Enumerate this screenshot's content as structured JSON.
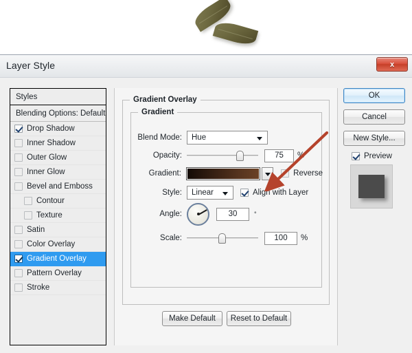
{
  "photo": {
    "alt": "two-dried-bay-leaves-on-white-background",
    "leaves": [
      {
        "name": "leaf-upper-left"
      },
      {
        "name": "leaf-lower-right"
      }
    ]
  },
  "dialog": {
    "title": "Layer Style",
    "close_label": "x"
  },
  "styles_panel": {
    "header": "Styles",
    "blending_options": "Blending Options: Default",
    "effects": [
      {
        "label": "Drop Shadow",
        "checked": true,
        "indent": false,
        "selected": false
      },
      {
        "label": "Inner Shadow",
        "checked": false,
        "indent": false,
        "selected": false
      },
      {
        "label": "Outer Glow",
        "checked": false,
        "indent": false,
        "selected": false
      },
      {
        "label": "Inner Glow",
        "checked": false,
        "indent": false,
        "selected": false
      },
      {
        "label": "Bevel and Emboss",
        "checked": false,
        "indent": false,
        "selected": false
      },
      {
        "label": "Contour",
        "checked": false,
        "indent": true,
        "selected": false
      },
      {
        "label": "Texture",
        "checked": false,
        "indent": true,
        "selected": false
      },
      {
        "label": "Satin",
        "checked": false,
        "indent": false,
        "selected": false
      },
      {
        "label": "Color Overlay",
        "checked": false,
        "indent": false,
        "selected": false
      },
      {
        "label": "Gradient Overlay",
        "checked": true,
        "indent": false,
        "selected": true
      },
      {
        "label": "Pattern Overlay",
        "checked": false,
        "indent": false,
        "selected": false
      },
      {
        "label": "Stroke",
        "checked": false,
        "indent": false,
        "selected": false
      }
    ]
  },
  "main": {
    "group_title": "Gradient Overlay",
    "subgroup_title": "Gradient",
    "blend_mode": {
      "label": "Blend Mode:",
      "value": "Hue"
    },
    "opacity": {
      "label": "Opacity:",
      "value": "75",
      "unit": "%",
      "percent": 75
    },
    "gradient": {
      "label": "Gradient:",
      "start_color": "#120a05",
      "end_color": "#6b4226",
      "reverse_label": "Reverse",
      "reverse_checked": false
    },
    "style": {
      "label": "Style:",
      "value": "Linear",
      "align_label": "Align with Layer",
      "align_checked": true
    },
    "angle": {
      "label": "Angle:",
      "value": "30",
      "unit": "°",
      "degrees": 30
    },
    "scale": {
      "label": "Scale:",
      "value": "100",
      "unit": "%",
      "percent": 50
    },
    "make_default": "Make Default",
    "reset_default": "Reset to Default"
  },
  "side": {
    "ok": "OK",
    "cancel": "Cancel",
    "new_style": "New Style...",
    "preview_label": "Preview",
    "preview_checked": true
  },
  "annotation": {
    "arrow_color": "#b5432c",
    "points_to": "opacity-value-field"
  }
}
